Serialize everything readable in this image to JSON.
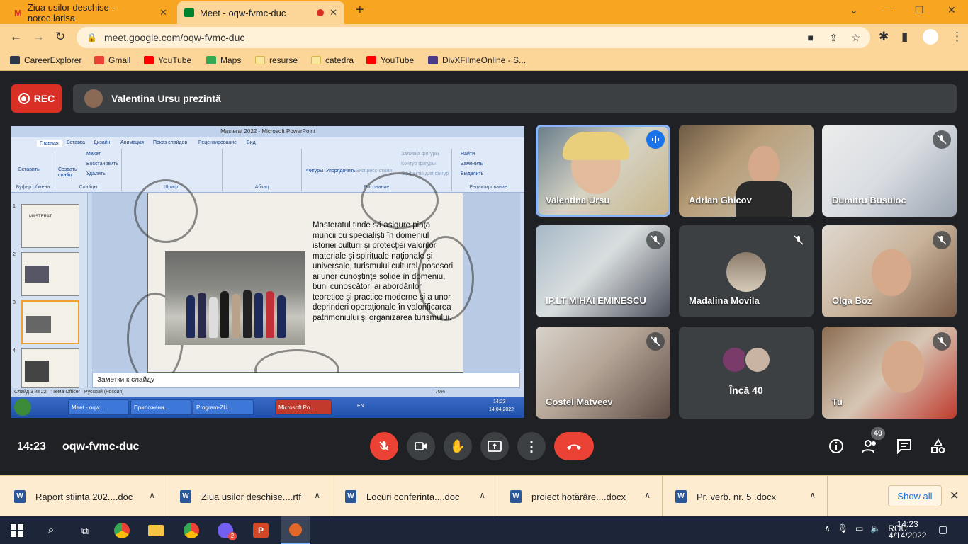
{
  "browser": {
    "tabs": [
      {
        "title": "Ziua usilor deschise - noroc.larisa",
        "icon": "gmail-icon"
      },
      {
        "title": "Meet - oqw-fvmc-duc",
        "icon": "meet-icon",
        "recording": true
      }
    ],
    "url": "meet.google.com/oqw-fvmc-duc",
    "bookmarks": [
      "CareerExplorer",
      "Gmail",
      "YouTube",
      "Maps",
      "resurse",
      "catedra",
      "YouTube",
      "DivXFilmeOnline - S..."
    ]
  },
  "meet": {
    "rec_label": "REC",
    "presenter": "Valentina Ursu prezintă",
    "clock": "14:23",
    "meeting_code": "oqw-fvmc-duc",
    "people_count": "49",
    "participants": [
      {
        "name": "Valentina Ursu",
        "speaking": true
      },
      {
        "name": "Adrian Ghicov",
        "muted": false
      },
      {
        "name": "Dumitru Busuioc",
        "muted": true
      },
      {
        "name": "IP.LT MIHAI EMINESCU",
        "muted": true
      },
      {
        "name": "Madalina Movila",
        "muted": true
      },
      {
        "name": "Olga Boz",
        "muted": true
      },
      {
        "name": "Costel Matveev",
        "muted": true
      },
      {
        "name": "Încă 40"
      },
      {
        "name": "Tu",
        "muted": true
      }
    ],
    "accent_red": "#ea4335"
  },
  "shared_screen": {
    "window_title": "Masterat 2022 - Microsoft PowerPoint",
    "ribbon_tabs": [
      "Главная",
      "Вставка",
      "Дизайн",
      "Анимация",
      "Показ слайдов",
      "Рецензирование",
      "Вид"
    ],
    "ribbon_groups": [
      "Буфер обмена",
      "Слайды",
      "Шрифт",
      "Абзац",
      "Рисование",
      "Редактирование"
    ],
    "ribbon_buttons": [
      "Вставить",
      "Создать слайд",
      "Макет",
      "Восстановить",
      "Удалить",
      "Фигуры",
      "Упорядочить",
      "Экспресс-стили",
      "Заливка фигуры",
      "Контур фигуры",
      "Эффекты для фигур",
      "Найти",
      "Заменить",
      "Выделить"
    ],
    "slide_text": "Masteratul tinde să asigure piaţa muncii cu specialişti în domeniul istoriei culturii şi protecţiei valorilor materiale şi spirituale naţionale şi universale, turismului cultural, posesori ai unor cunoştinţe solide în domeniu, buni cunoscători ai abordărilor teoretice şi practice moderne şi a unor deprinderi operaţionale în valorificarea patrimoniului şi organizarea turismului.",
    "thumb1_title": "MASTERAT",
    "notes_placeholder": "Заметки к слайду",
    "status": [
      "Слайд 3 из 22",
      "\"Тема Office\"",
      "Русский (Россия)"
    ],
    "zoom": "70%",
    "thumb_numbers": [
      "1",
      "2",
      "3",
      "4"
    ],
    "xp_taskbar": [
      "Meet - oqw...",
      "Приложени...",
      "Program-ZU...",
      "Microsoft Po..."
    ],
    "xp_lang": "EN",
    "xp_time": "14:23",
    "xp_date": "14.04.2022"
  },
  "downloads": {
    "items": [
      "Raport stiinta 202....doc",
      "Ziua usilor deschise....rtf",
      "Locuri  conferinta....doc",
      "proiect hotărâre....docx",
      "Pr. verb. nr. 5 .docx"
    ],
    "show_all": "Show all"
  },
  "taskbar": {
    "lang": "ROU",
    "time": "14:23",
    "date": "4/14/2022",
    "viber_badge": "2"
  }
}
